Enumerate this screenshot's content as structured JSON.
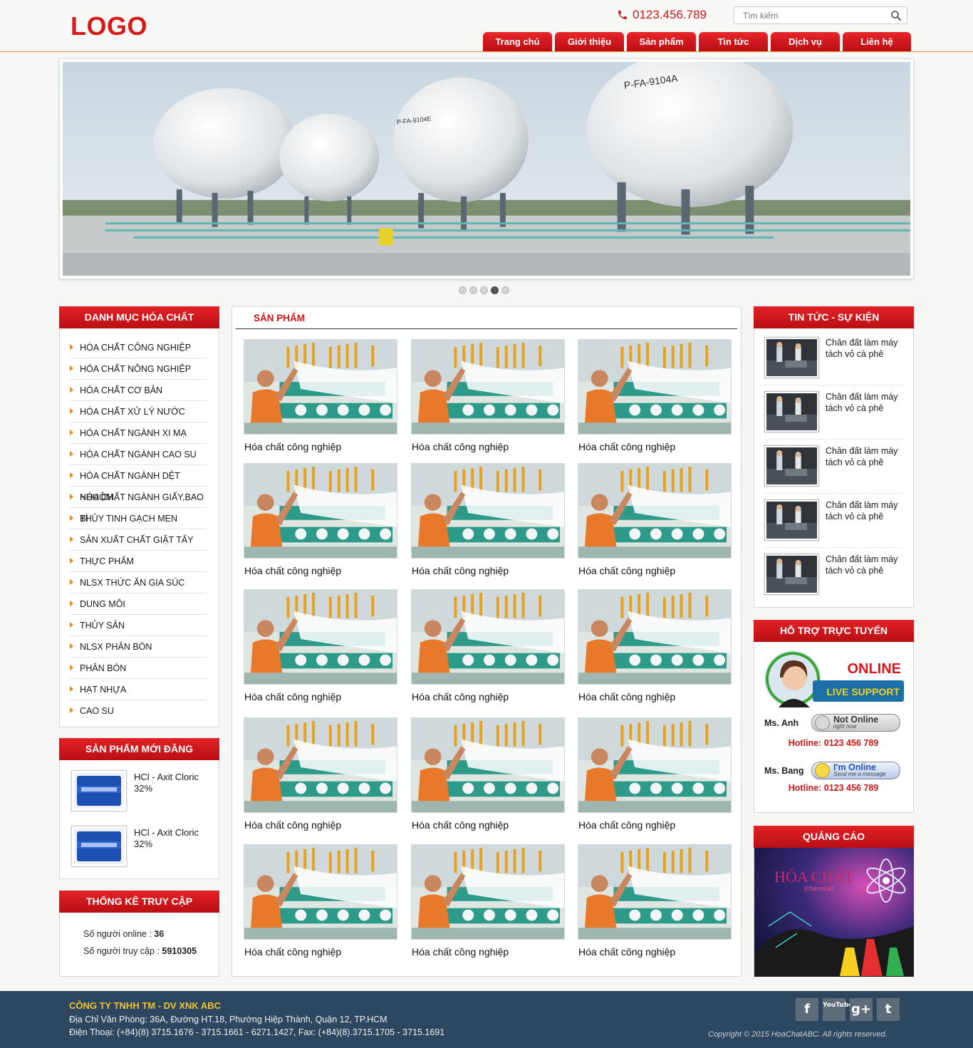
{
  "header": {
    "logo": "LOGO",
    "phone": "0123.456.789",
    "search_placeholder": "Tìm kiếm"
  },
  "nav": [
    "Trang chủ",
    "Giới thiệu",
    "Sản phẩm",
    "Tin tức",
    "Dịch vụ",
    "Liên hệ"
  ],
  "slider": {
    "tank_labels": [
      "P-FA-9104A",
      "P-FA-9104E"
    ],
    "dots": 5,
    "active_dot": 4
  },
  "categories": {
    "title": "DANH MỤC HÓA CHẤT",
    "items": [
      "HÓA CHẤT CÔNG NGHIỆP",
      "HÓA CHẤT NÔNG NGHIỆP",
      "HÓA CHẤT CƠ BẢN",
      "HÓA CHẤT XỬ LÝ NƯỚC",
      "HÓA CHẤT NGÀNH XI MẠ",
      "HÓA CHẤT NGÀNH CAO SU",
      "HÓA CHẤT NGÀNH DỆT NHUỘM",
      "HÓA CHẤT NGÀNH GIẤY,BAO BÌ",
      "THỦY TINH GẠCH MEN",
      "SẢN XUẤT CHẤT GIẶT TẨY",
      "THỰC PHẨM",
      "NLSX THỨC ĂN GIA SÚC",
      "DUNG MÔI",
      "THỦY SẢN",
      "NLSX PHÂN BÓN",
      "PHÂN BÓN",
      "HẠT NHỰA",
      "CAO SU"
    ]
  },
  "new_products": {
    "title": "SẢN PHẨM MỚI ĐĂNG",
    "items": [
      "HCl - Axit Cloric 32%",
      "HCl - Axit Cloric 32%"
    ]
  },
  "stats": {
    "title": "THỐNG KÊ TRUY CẬP",
    "online_label": "Số người online :",
    "online_value": "36",
    "visits_label": "Số người truy cập :",
    "visits_value": "5910305"
  },
  "products": {
    "title": "SẢN PHẨM",
    "items": [
      "Hóa chất công nghiệp",
      "Hóa chất công nghiệp",
      "Hóa chất công nghiệp",
      "Hóa chất công nghiệp",
      "Hóa chất công nghiệp",
      "Hóa chất công nghiệp",
      "Hóa chất công nghiệp",
      "Hóa chất công nghiệp",
      "Hóa chất công nghiệp",
      "Hóa chất công nghiệp",
      "Hóa chất công nghiệp",
      "Hóa chất công nghiệp",
      "Hóa chất công nghiệp",
      "Hóa chất công nghiệp",
      "Hóa chất công nghiệp"
    ]
  },
  "news": {
    "title": "TIN TỨC - SỰ KIỆN",
    "items": [
      "Chân đất làm máy tách vỏ cà phê",
      "Chân đất làm máy tách vỏ cà phê",
      "Chân đất làm máy tách vỏ cà phê",
      "Chân đất làm máy tách vỏ cà phê",
      "Chân đất làm máy tách vỏ cà phê"
    ]
  },
  "support": {
    "title": "HỖ TRỢ TRỰC TUYẾN",
    "banner_line1": "ONLINE",
    "banner_line2": "LIVE SUPPORT",
    "agents": [
      {
        "name": "Ms. Anh",
        "status": "Not Online",
        "status_sub": "right now",
        "hotline": "Hotline: 0123 456 789"
      },
      {
        "name": "Ms. Bang",
        "status": "I'm Online",
        "status_sub": "Send me a message",
        "hotline": "Hotline: 0123 456 789"
      }
    ]
  },
  "ads": {
    "title": "QUẢNG CÁO",
    "image_text": "HÓA CHẤT",
    "image_subtext": "(chemical)"
  },
  "footer": {
    "company": "CÔNG TY TNHH TM - DV XNK  ABC",
    "address": "Địa Chỉ Văn Phòng: 36A, Đường HT.18, Phường Hiệp Thành, Quận 12, TP.HCM",
    "phone": "Điện Thoại: (+84)(8) 3715.1676 - 3715.1661 - 6271.1427, Fax: (+84)(8).3715.1705 - 3715.1691",
    "social": [
      "f",
      "YouTube",
      "g+",
      "t"
    ],
    "copyright": "Copyright © 2015 HoaChatABC. All rights reserved."
  },
  "colors": {
    "brand_red": "#d41c1c",
    "title_gradient_top": "#e32226",
    "title_gradient_bottom": "#b80f14",
    "footer_bg": "#2e4761",
    "footer_company": "#f1c530",
    "accent_orange": "#e08a2a"
  },
  "icons": {
    "phone": "phone-icon",
    "search": "search-icon",
    "category_arrow": "caret-right-icon",
    "facebook": "facebook-icon",
    "youtube": "youtube-icon",
    "googleplus": "google-plus-icon",
    "tumblr": "tumblr-icon"
  }
}
